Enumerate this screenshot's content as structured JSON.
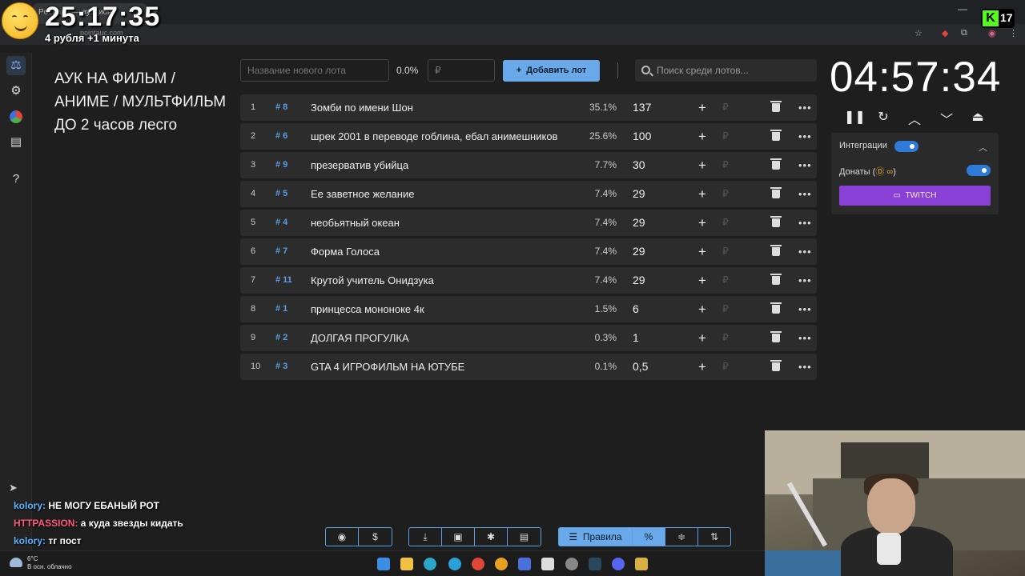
{
  "browser": {
    "tab_title": "Pointauc — аукцион",
    "url": "pointauc.com",
    "new_tab": "+",
    "win_min": "—",
    "win_max": "▢",
    "win_close": "✕"
  },
  "overlay": {
    "time": "25:17:35",
    "subtitle": "4 рубля +1 минута",
    "kick_count": "17",
    "kick_letter": "K"
  },
  "sidebar": {
    "items": [
      "auction",
      "settings",
      "statistics",
      "history",
      "help"
    ]
  },
  "title": "АУК НА ФИЛЬМ / АНИМЕ / МУЛЬТФИЛЬМ ДО 2 часов лесго",
  "new_lot": {
    "name_placeholder": "Название нового лота",
    "percent": "0.0%",
    "amount_placeholder": "₽",
    "add_button": "Добавить лот",
    "add_icon": "+"
  },
  "search": {
    "placeholder": "Поиск среди лотов..."
  },
  "lots": [
    {
      "num": "1",
      "id": "# 8",
      "name": "Зомби по имени Шон",
      "percent": "35.1%",
      "amount": "137"
    },
    {
      "num": "2",
      "id": "# 6",
      "name": "шрек 2001 в переводе гоблина, ебал анимешников",
      "percent": "25.6%",
      "amount": "100"
    },
    {
      "num": "3",
      "id": "# 9",
      "name": "презерватив убийца",
      "percent": "7.7%",
      "amount": "30"
    },
    {
      "num": "4",
      "id": "# 5",
      "name": "Ее заветное желание",
      "percent": "7.4%",
      "amount": "29"
    },
    {
      "num": "5",
      "id": "# 4",
      "name": "необьятный океан",
      "percent": "7.4%",
      "amount": "29"
    },
    {
      "num": "6",
      "id": "# 7",
      "name": "Форма Голоса",
      "percent": "7.4%",
      "amount": "29"
    },
    {
      "num": "7",
      "id": "# 11",
      "name": "Крутой учитель Онидзука",
      "percent": "7.4%",
      "amount": "29"
    },
    {
      "num": "8",
      "id": "# 1",
      "name": "принцесса мононоке 4к",
      "percent": "1.5%",
      "amount": "6"
    },
    {
      "num": "9",
      "id": "# 2",
      "name": "ДОЛГАЯ ПРОГУЛКА",
      "percent": "0.3%",
      "amount": "1"
    },
    {
      "num": "10",
      "id": "# 3",
      "name": "GTA 4 ИГРОФИЛЬМ НА ЮТУБЕ",
      "percent": "0.1%",
      "amount": "0,5"
    }
  ],
  "row_icons": {
    "plus": "+",
    "rub": "₽",
    "more": "•••"
  },
  "timer": {
    "display": "04:57:34",
    "controls": [
      "❚❚",
      "↻",
      "︿",
      "﹀",
      "⏏"
    ]
  },
  "integrations": {
    "label": "Интеграции",
    "donations_label": "Донаты (",
    "donations_icons": "Ⓓ ∞",
    "donations_close": ")",
    "chevron": "︿",
    "twitch_label": "TWITCH"
  },
  "toolbar": {
    "github": "◉",
    "donate": "$",
    "download": "⤓",
    "save": "▣",
    "bug": "✱",
    "clear": "▤",
    "rules_icon": "☰",
    "rules": "Правила",
    "percent": "%",
    "split": "≑",
    "sort": "⇅"
  },
  "chat": [
    {
      "user": "kolory:",
      "message": "НЕ МОГУ ЕБАНЫЙ РОТ"
    },
    {
      "user": "HTTPASSION:",
      "message": "а куда звезды кидать"
    },
    {
      "user": "kolory:",
      "message": "тг пост"
    }
  ],
  "taskbar": {
    "temp": "6°C",
    "weather": "В осн. облачно"
  },
  "colors": {
    "accent": "#6aa9e9",
    "lot_id": "#5a9fe8",
    "twitch": "#8a3fd6",
    "toggle": "#2f7ad8"
  }
}
